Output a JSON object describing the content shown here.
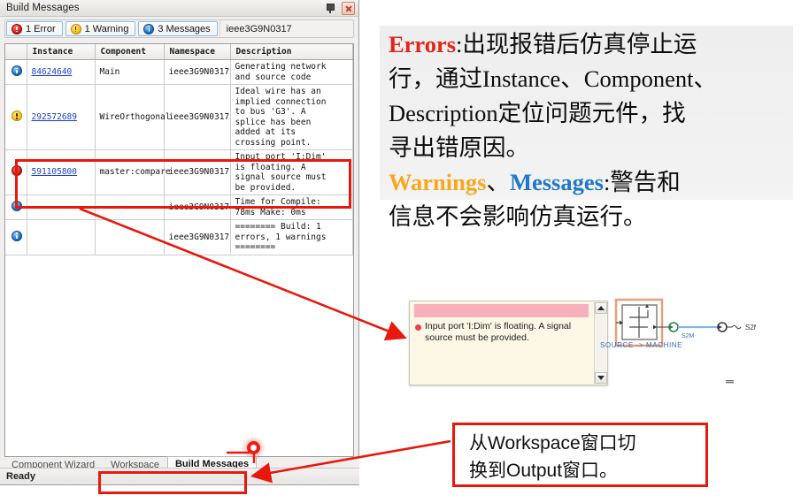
{
  "window": {
    "title": "Build Messages",
    "pin_icon": "pin-icon",
    "close_icon": "close-icon",
    "status_text": "Ready"
  },
  "filterbar": {
    "buttons": [
      {
        "label": "1 Error",
        "icon": "error-icon"
      },
      {
        "label": "1 Warning",
        "icon": "warning-icon"
      },
      {
        "label": "3 Messages",
        "icon": "info-icon"
      }
    ],
    "namespace_label": "ieee3G9N0317"
  },
  "grid": {
    "columns": [
      "",
      "Instance",
      "Component",
      "Namespace",
      "Description"
    ],
    "rows": [
      {
        "icon": "info-icon",
        "instance": "84624640",
        "component": "Main",
        "namespace": "ieee3G9N0317",
        "description": "Generating network\nand source code"
      },
      {
        "icon": "warning-icon",
        "instance": "292572689",
        "component": "WireOrthogonal",
        "namespace": "ieee3G9N0317",
        "description": "Ideal wire has an\nimplied connection\nto bus 'G3'. A\nsplice has been\nadded at its\ncrossing point."
      },
      {
        "icon": "error-icon",
        "instance": "591105800",
        "component": "master:compare",
        "namespace": "ieee3G9N0317",
        "description": "Input port 'I:Dim'\nis floating. A\nsignal source must\nbe provided."
      },
      {
        "icon": "info-icon",
        "instance": "",
        "component": "",
        "namespace": "ieee3G9N0317",
        "description": "Time for Compile:\n78ms  Make: 0ms"
      },
      {
        "icon": "info-icon",
        "instance": "",
        "component": "",
        "namespace": "ieee3G9N0317",
        "description": "======== Build: 1\nerrors, 1 warnings\n========"
      }
    ]
  },
  "dock_tabs": [
    {
      "label": "Component Wizard",
      "active": false
    },
    {
      "label": "Workspace",
      "active": false
    },
    {
      "label": "Build Messages",
      "active": true
    }
  ],
  "text_panel": {
    "lines": [
      [
        {
          "text": "Errors",
          "style": "kw-err"
        },
        {
          "text": ":出现报错后仿真停止运",
          "style": ""
        }
      ],
      [
        {
          "text": "行，通过Instance、Component、",
          "style": ""
        }
      ],
      [
        {
          "text": "Description定位问题元件，找",
          "style": ""
        }
      ],
      [
        {
          "text": "寻出错原因。",
          "style": ""
        }
      ],
      [
        {
          "text": "Warnings",
          "style": "kw-warn"
        },
        {
          "text": "、",
          "style": ""
        },
        {
          "text": "Messages",
          "style": "kw-msg"
        },
        {
          "text": ":警告和",
          "style": ""
        }
      ],
      [
        {
          "text": "信息不会影响仿真运行。",
          "style": ""
        }
      ]
    ]
  },
  "tooltip": {
    "bullet_icon": "error-dot-icon",
    "message": "Input port 'I:Dim' is floating. A signal source must be provided.",
    "scroll_up_icon": "scroll-up-arrow-icon",
    "scroll_down_icon": "scroll-down-arrow-icon"
  },
  "circuit": {
    "label": "SOURCE -> MACHINE",
    "net_label_1": "S2M",
    "net_label_2": "S2M"
  },
  "callout": {
    "lines": [
      "从Workspace窗口切",
      "换到Output窗口。"
    ]
  },
  "colors": {
    "error": "#e2241a",
    "warning": "#f5a81c",
    "message": "#1f78c8",
    "annotation_red": "#e8180c",
    "link_blue": "#1a3fd0"
  }
}
